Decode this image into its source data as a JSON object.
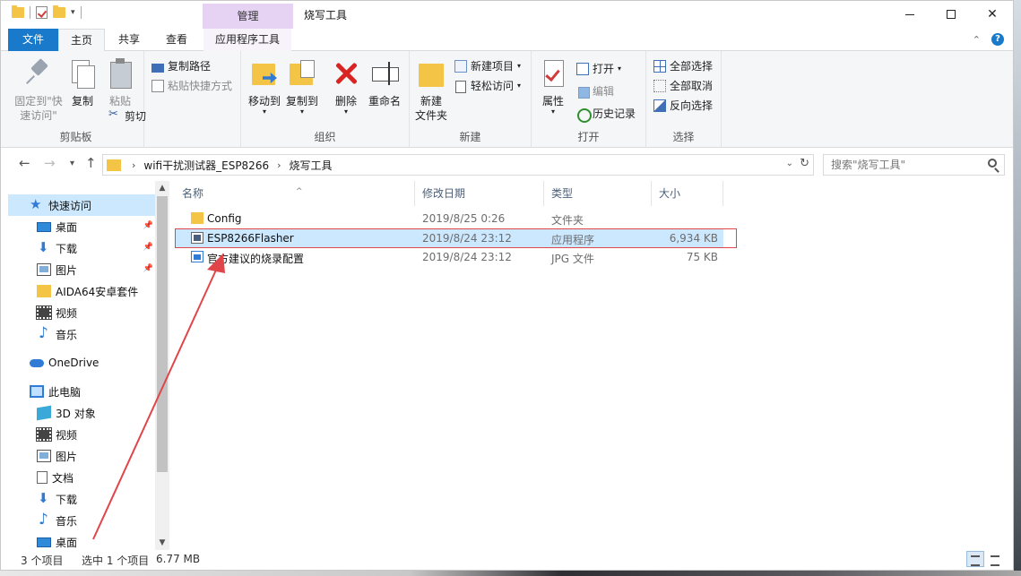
{
  "titlebar": {
    "manage_tab": "管理",
    "title": "烧写工具"
  },
  "tabs": {
    "file": "文件",
    "home": "主页",
    "share": "共享",
    "view": "查看",
    "app_tools": "应用程序工具"
  },
  "ribbon": {
    "clipboard": {
      "label": "剪贴板",
      "pin": "固定到\"快\n速访问\"",
      "copy": "复制",
      "paste": "粘贴",
      "copy_path": "复制路径",
      "paste_shortcut": "粘贴快捷方式",
      "cut": "剪切"
    },
    "organize": {
      "label": "组织",
      "move_to": "移动到",
      "copy_to": "复制到",
      "delete": "删除",
      "rename": "重命名"
    },
    "new": {
      "label": "新建",
      "new_folder": "新建\n文件夹",
      "new_item": "新建项目",
      "easy_access": "轻松访问"
    },
    "open": {
      "label": "打开",
      "properties": "属性",
      "open": "打开",
      "edit": "编辑",
      "history": "历史记录"
    },
    "select": {
      "label": "选择",
      "select_all": "全部选择",
      "select_none": "全部取消",
      "invert": "反向选择"
    }
  },
  "address": {
    "crumbs": [
      "wifi干扰测试器_ESP8266",
      "烧写工具"
    ],
    "search_placeholder": "搜索\"烧写工具\""
  },
  "navpane": {
    "items": [
      {
        "label": "快速访问",
        "icon": "star-icon"
      },
      {
        "label": "桌面",
        "icon": "desktop-icon"
      },
      {
        "label": "下载",
        "icon": "download-icon"
      },
      {
        "label": "图片",
        "icon": "pictures-icon"
      },
      {
        "label": "AIDA64安卓套件",
        "icon": "folder-icon"
      },
      {
        "label": "视频",
        "icon": "video-icon"
      },
      {
        "label": "音乐",
        "icon": "music-icon"
      },
      {
        "label": "OneDrive",
        "icon": "cloud-icon"
      },
      {
        "label": "此电脑",
        "icon": "pc-icon"
      },
      {
        "label": "3D 对象",
        "icon": "3d-objects-icon"
      },
      {
        "label": "视频",
        "icon": "video-icon"
      },
      {
        "label": "图片",
        "icon": "pictures-icon"
      },
      {
        "label": "文档",
        "icon": "documents-icon"
      },
      {
        "label": "下载",
        "icon": "download-icon"
      },
      {
        "label": "音乐",
        "icon": "music-icon"
      },
      {
        "label": "桌面",
        "icon": "desktop-icon"
      }
    ]
  },
  "columns": {
    "name": "名称",
    "date": "修改日期",
    "type": "类型",
    "size": "大小"
  },
  "files": [
    {
      "name": "Config",
      "date": "2019/8/25 0:26",
      "type": "文件夹",
      "size": "",
      "icon": "folder-icon"
    },
    {
      "name": "ESP8266Flasher",
      "date": "2019/8/24 23:12",
      "type": "应用程序",
      "size": "6,934 KB",
      "icon": "exe-icon"
    },
    {
      "name": "官方建议的烧录配置",
      "date": "2019/8/24 23:12",
      "type": "JPG 文件",
      "size": "75 KB",
      "icon": "jpg-icon"
    }
  ],
  "status": {
    "count": "3 个项目",
    "selected": "选中 1 个项目",
    "size": "6.77 MB"
  },
  "colors": {
    "accent": "#1979ca",
    "selection": "#cce8ff",
    "annotation": "#e0454a"
  }
}
